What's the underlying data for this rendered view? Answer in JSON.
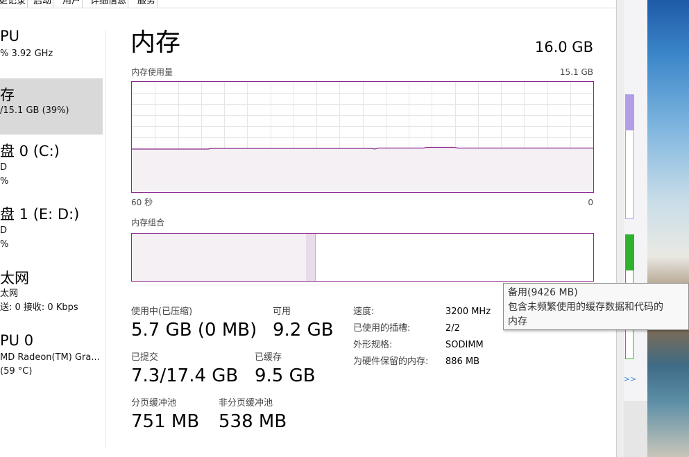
{
  "tabs": [
    "更记录",
    "启动",
    "用户",
    "详细信息",
    "服务"
  ],
  "sidebar": [
    {
      "title": "PU",
      "lines": [
        "%  3.92 GHz"
      ],
      "selected": false
    },
    {
      "title": "存",
      "lines": [
        "/15.1 GB (39%)"
      ],
      "selected": true
    },
    {
      "title": "盘 0 (C:)",
      "lines": [
        "D",
        "%"
      ],
      "selected": false
    },
    {
      "title": "盘 1 (E: D:)",
      "lines": [
        "D",
        "%"
      ],
      "selected": false
    },
    {
      "title": "太网",
      "lines": [
        "太网",
        "送: 0 接收: 0 Kbps"
      ],
      "selected": false
    },
    {
      "title": "PU 0",
      "lines": [
        "MD Radeon(TM) Gra...",
        "(59 °C)"
      ],
      "selected": false
    }
  ],
  "header": {
    "title": "内存",
    "total": "16.0 GB"
  },
  "usage_graph": {
    "label": "内存使用量",
    "max_label": "15.1 GB",
    "time_left": "60 秒",
    "time_right": "0",
    "usage_fraction": 0.39,
    "line_color": "#8b2a8e"
  },
  "composition": {
    "label": "内存组合",
    "in_use_fraction": 0.377,
    "modified_fraction": 0.019
  },
  "stats": {
    "in_use_label": "使用中(已压缩)",
    "in_use_value": "5.7 GB (0 MB)",
    "available_label": "可用",
    "available_value": "9.2 GB",
    "committed_label": "已提交",
    "committed_value": "7.3/17.4 GB",
    "cached_label": "已缓存",
    "cached_value": "9.5 GB",
    "paged_label": "分页缓冲池",
    "paged_value": "751 MB",
    "nonpaged_label": "非分页缓冲池",
    "nonpaged_value": "538 MB"
  },
  "specs": [
    {
      "label": "速度:",
      "value": "3200 MHz"
    },
    {
      "label": "已使用的插槽:",
      "value": "2/2"
    },
    {
      "label": "外形规格:",
      "value": "SODIMM"
    },
    {
      "label": "为硬件保留的内存:",
      "value": "886 MB"
    }
  ],
  "tooltip": {
    "title": "备用(9426 MB)",
    "body1": "包含未频繁使用的缓存数据和代码的",
    "body2": "内存"
  },
  "colors": {
    "accent": "#8b2a8e",
    "fill": "#f4f0f4",
    "selected_bg": "#d9d9d9"
  }
}
